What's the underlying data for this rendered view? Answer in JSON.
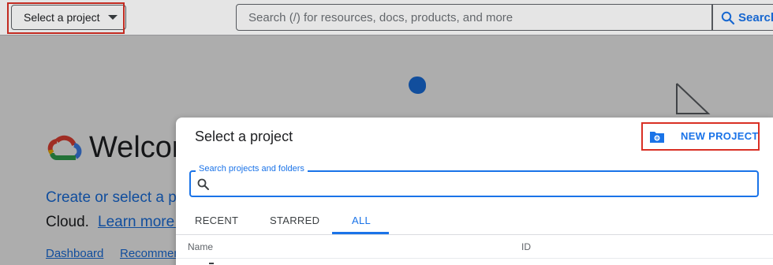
{
  "topbar": {
    "project_picker_label": "Select a project",
    "search_placeholder": "Search (/) for resources, docs, products, and more",
    "search_button_label": "Search"
  },
  "background": {
    "welcome_text": "Welcom",
    "create_text": "Create or select a pr",
    "cloud_text": "Cloud.",
    "learn_more_text": "Learn more a",
    "nav_links": [
      "Dashboard",
      "Recommen"
    ]
  },
  "dialog": {
    "title": "Select a project",
    "new_project_label": "NEW PROJECT",
    "search_label": "Search projects and folders",
    "search_value": "",
    "tabs": [
      {
        "label": "RECENT",
        "active": false
      },
      {
        "label": "STARRED",
        "active": false
      },
      {
        "label": "ALL",
        "active": true
      }
    ],
    "columns": [
      "Name",
      "ID"
    ]
  },
  "colors": {
    "accent": "#1a73e8",
    "highlight": "#d93025",
    "text": "#202124",
    "muted": "#5f6368"
  },
  "icons": [
    "caret-down-icon",
    "search-icon",
    "google-cloud-logo",
    "folder-gear-icon"
  ]
}
